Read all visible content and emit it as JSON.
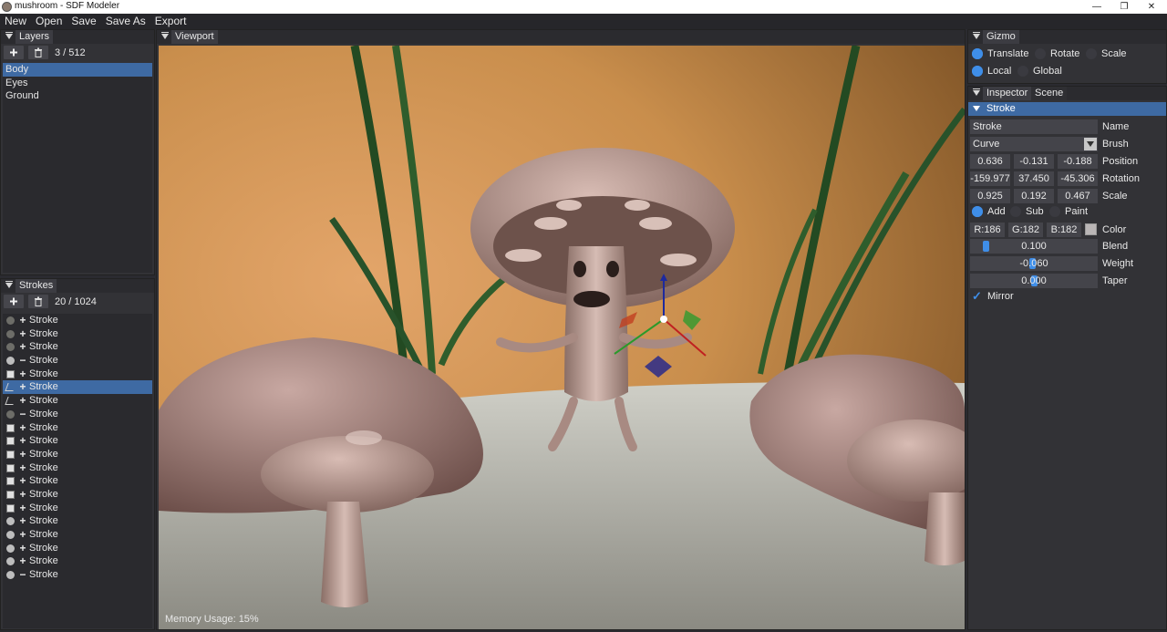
{
  "window": {
    "title": "mushroom - SDF Modeler",
    "minimize": "—",
    "restore": "❐",
    "close": "✕"
  },
  "menu": [
    "New",
    "Open",
    "Save",
    "Save As",
    "Export"
  ],
  "layers": {
    "tab": "Layers",
    "count": "3 / 512",
    "items": [
      "Body",
      "Eyes",
      "Ground"
    ],
    "selected_index": 0
  },
  "strokes": {
    "tab": "Strokes",
    "count": "20 / 1024",
    "items": [
      {
        "icon": "sphere-dark",
        "op": "+",
        "label": "Stroke"
      },
      {
        "icon": "sphere-dark",
        "op": "+",
        "label": "Stroke"
      },
      {
        "icon": "sphere-dark",
        "op": "+",
        "label": "Stroke"
      },
      {
        "icon": "sphere",
        "op": "−",
        "label": "Stroke"
      },
      {
        "icon": "cube",
        "op": "+",
        "label": "Stroke"
      },
      {
        "icon": "curve",
        "op": "+",
        "label": "Stroke",
        "selected": true
      },
      {
        "icon": "curve",
        "op": "+",
        "label": "Stroke"
      },
      {
        "icon": "sphere-dark",
        "op": "−",
        "label": "Stroke"
      },
      {
        "icon": "cube",
        "op": "+",
        "label": "Stroke"
      },
      {
        "icon": "cube",
        "op": "+",
        "label": "Stroke"
      },
      {
        "icon": "cube",
        "op": "+",
        "label": "Stroke"
      },
      {
        "icon": "cube",
        "op": "+",
        "label": "Stroke"
      },
      {
        "icon": "cube",
        "op": "+",
        "label": "Stroke"
      },
      {
        "icon": "cube",
        "op": "+",
        "label": "Stroke"
      },
      {
        "icon": "cube",
        "op": "+",
        "label": "Stroke"
      },
      {
        "icon": "sphere",
        "op": "+",
        "label": "Stroke"
      },
      {
        "icon": "sphere",
        "op": "+",
        "label": "Stroke"
      },
      {
        "icon": "sphere",
        "op": "+",
        "label": "Stroke"
      },
      {
        "icon": "sphere",
        "op": "+",
        "label": "Stroke"
      },
      {
        "icon": "sphere",
        "op": "−",
        "label": "Stroke"
      }
    ]
  },
  "viewport": {
    "tab": "Viewport",
    "memory_usage": "Memory Usage: 15%"
  },
  "gizmo": {
    "tab": "Gizmo",
    "modes": [
      "Translate",
      "Rotate",
      "Scale"
    ],
    "mode_selected": 0,
    "spaces": [
      "Local",
      "Global"
    ],
    "space_selected": 0
  },
  "inspector": {
    "tabs": [
      "Inspector",
      "Scene"
    ],
    "section": "Stroke",
    "name_value": "Stroke",
    "name_label": "Name",
    "brush_value": "Curve",
    "brush_label": "Brush",
    "position": [
      "0.636",
      "-0.131",
      "-0.188"
    ],
    "position_label": "Position",
    "rotation": [
      "-159.977",
      "37.450",
      "-45.306"
    ],
    "rotation_label": "Rotation",
    "scale": [
      "0.925",
      "0.192",
      "0.467"
    ],
    "scale_label": "Scale",
    "ops": [
      "Add",
      "Sub",
      "Paint"
    ],
    "op_selected": 0,
    "color": [
      "R:186",
      "G:182",
      "B:182"
    ],
    "color_label": "Color",
    "color_hex": "#bab6b6",
    "blend": "0.100",
    "blend_label": "Blend",
    "weight": "-0.060",
    "weight_label": "Weight",
    "taper": "0.000",
    "taper_label": "Taper",
    "mirror_label": "Mirror",
    "mirror_checked": true
  }
}
